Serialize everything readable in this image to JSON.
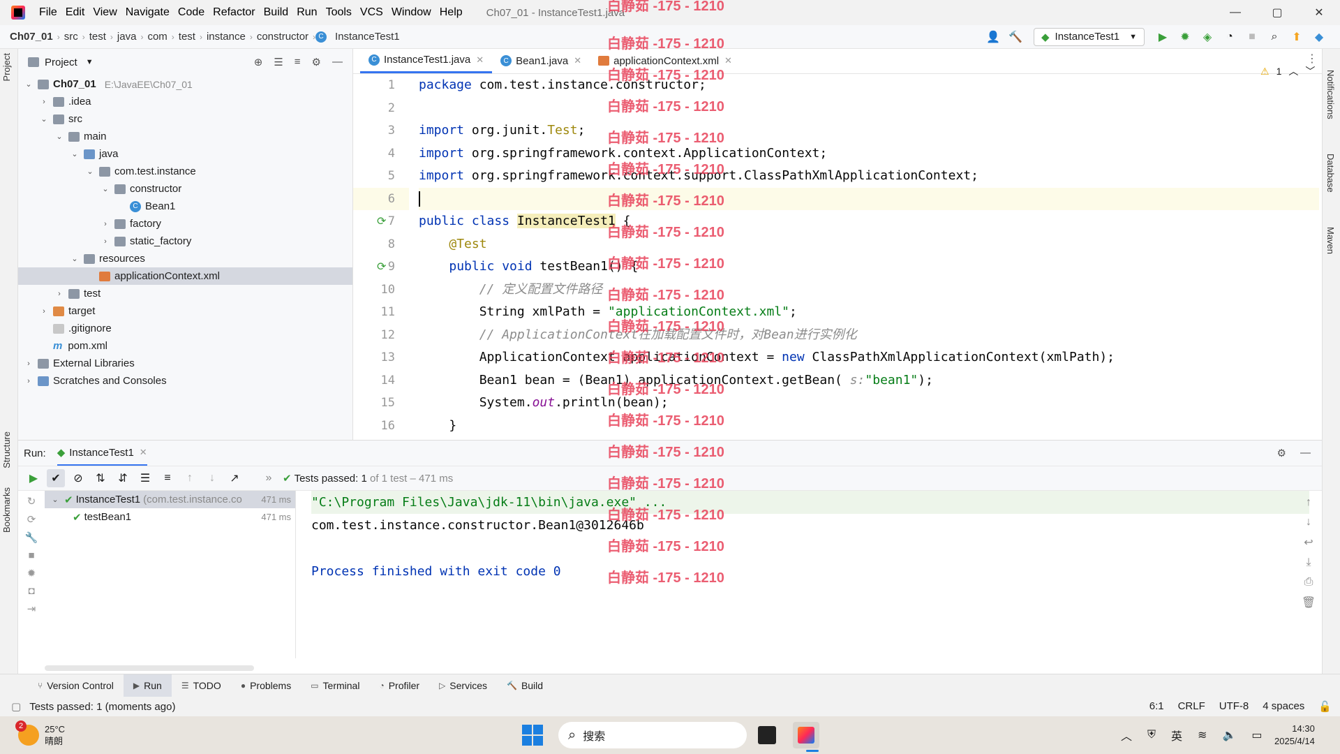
{
  "window": {
    "title": "Ch07_01 - InstanceTest1.java",
    "minimize_icon": "—",
    "maximize_icon": "▢",
    "close_icon": "✕"
  },
  "menu": [
    "File",
    "Edit",
    "View",
    "Navigate",
    "Code",
    "Refactor",
    "Build",
    "Run",
    "Tools",
    "VCS",
    "Window",
    "Help"
  ],
  "breadcrumb": [
    "Ch07_01",
    "src",
    "test",
    "java",
    "com",
    "test",
    "instance",
    "constructor",
    "InstanceTest1"
  ],
  "toolbar": {
    "run_config": "InstanceTest1"
  },
  "project": {
    "header": "Project",
    "tree": [
      {
        "label": "Ch07_01",
        "extra": "E:\\JavaEE\\Ch07_01",
        "depth": 0,
        "open": true,
        "icon": "module-folder",
        "bold": true
      },
      {
        "label": ".idea",
        "depth": 1,
        "open": false,
        "icon": "folder"
      },
      {
        "label": "src",
        "depth": 1,
        "open": true,
        "icon": "folder"
      },
      {
        "label": "main",
        "depth": 2,
        "open": true,
        "icon": "folder"
      },
      {
        "label": "java",
        "depth": 3,
        "open": true,
        "icon": "source-folder"
      },
      {
        "label": "com.test.instance",
        "depth": 4,
        "open": true,
        "icon": "package"
      },
      {
        "label": "constructor",
        "depth": 5,
        "open": true,
        "icon": "package"
      },
      {
        "label": "Bean1",
        "depth": 6,
        "icon": "class"
      },
      {
        "label": "factory",
        "depth": 5,
        "open": false,
        "icon": "package"
      },
      {
        "label": "static_factory",
        "depth": 5,
        "open": false,
        "icon": "package"
      },
      {
        "label": "resources",
        "depth": 3,
        "open": true,
        "icon": "resources-folder"
      },
      {
        "label": "applicationContext.xml",
        "depth": 4,
        "icon": "xml",
        "selected": true
      },
      {
        "label": "test",
        "depth": 2,
        "open": false,
        "icon": "folder"
      },
      {
        "label": "target",
        "depth": 1,
        "open": false,
        "icon": "excluded-folder"
      },
      {
        "label": ".gitignore",
        "depth": 1,
        "icon": "file"
      },
      {
        "label": "pom.xml",
        "depth": 1,
        "icon": "maven"
      },
      {
        "label": "External Libraries",
        "depth": 0,
        "open": false,
        "icon": "libraries"
      },
      {
        "label": "Scratches and Consoles",
        "depth": 0,
        "open": false,
        "icon": "scratches"
      }
    ]
  },
  "tabs": [
    {
      "label": "InstanceTest1.java",
      "active": true
    },
    {
      "label": "Bean1.java",
      "active": false
    },
    {
      "label": "applicationContext.xml",
      "active": false
    }
  ],
  "editor": {
    "warning_count": "1",
    "line_numbers": [
      "1",
      "2",
      "3",
      "4",
      "5",
      "6",
      "7",
      "8",
      "9",
      "10",
      "11",
      "12",
      "13",
      "14",
      "15",
      "16"
    ],
    "lines": [
      [
        [
          "kw",
          "package"
        ],
        [
          "",
          "com.test.instance.constructor;"
        ]
      ],
      [],
      [
        [
          "kw",
          "import"
        ],
        [
          "",
          "org.junit."
        ],
        [
          "ann",
          "Test"
        ],
        [
          "",
          ";"
        ]
      ],
      [
        [
          "kw",
          "import"
        ],
        [
          "",
          "org.springframework.context.ApplicationContext;"
        ]
      ],
      [
        [
          "kw",
          "import"
        ],
        [
          "",
          "org.springframework.context.support.ClassPathXmlApplicationContext;"
        ]
      ],
      [],
      [
        [
          "kw",
          "public class"
        ],
        [
          "",
          ""
        ],
        [
          "cls",
          "InstanceTest1"
        ],
        [
          "",
          " {"
        ]
      ],
      [
        [
          "",
          "    "
        ],
        [
          "ann",
          "@Test"
        ]
      ],
      [
        [
          "",
          "    "
        ],
        [
          "kw",
          "public void"
        ],
        [
          "",
          " testBean1() {"
        ]
      ],
      [
        [
          "",
          "        "
        ],
        [
          "cmt",
          "// 定义配置文件路径"
        ]
      ],
      [
        [
          "",
          "        String xmlPath = "
        ],
        [
          "str",
          "\"applicationContext.xml\""
        ],
        [
          "",
          ";"
        ]
      ],
      [
        [
          "",
          "        "
        ],
        [
          "cmt",
          "// ApplicationContext在加载配置文件时，对Bean进行实例化"
        ]
      ],
      [
        [
          "",
          "        ApplicationContext applicationContext = "
        ],
        [
          "kw",
          "new"
        ],
        [
          "",
          " ClassPathXmlApplicationContext(xmlPath);"
        ]
      ],
      [
        [
          "",
          "        Bean1 bean = (Bean1) applicationContext.getBean( "
        ],
        [
          "cmt",
          "s:"
        ],
        [
          " ",
          ""
        ],
        [
          "str",
          "\"bean1\""
        ],
        [
          "",
          ");"
        ]
      ],
      [
        [
          "",
          "        System."
        ],
        [
          "ital",
          "out"
        ],
        [
          "",
          ".println(bean);"
        ]
      ],
      [
        [
          "",
          "    }"
        ]
      ]
    ]
  },
  "run": {
    "label": "Run:",
    "tab": "InstanceTest1",
    "status_prefix": "Tests passed:",
    "status_count": "1",
    "status_suffix": "of 1 test – 471 ms",
    "tests": [
      {
        "name": "InstanceTest1",
        "detail": "(com.test.instance.co",
        "time": "471 ms"
      },
      {
        "name": "testBean1",
        "detail": "",
        "time": "471 ms"
      }
    ],
    "console": [
      {
        "text": "\"C:\\Program Files\\Java\\jdk-11\\bin\\java.exe\" ...",
        "color": "#067d17"
      },
      {
        "text": "com.test.instance.constructor.Bean1@3012646b",
        "color": "#080808"
      },
      {
        "text": "",
        "color": "#080808"
      },
      {
        "text": "Process finished with exit code 0",
        "color": "#0033b3"
      }
    ]
  },
  "bottom_tabs": [
    "Version Control",
    "Run",
    "TODO",
    "Problems",
    "Terminal",
    "Profiler",
    "Services",
    "Build"
  ],
  "status": {
    "message": "Tests passed: 1 (moments ago)",
    "position": "6:1",
    "line_sep": "CRLF",
    "encoding": "UTF-8",
    "indent": "4 spaces"
  },
  "side_labels": {
    "project": "Project",
    "structure": "Structure",
    "bookmarks": "Bookmarks",
    "notifications": "Notifications",
    "database": "Database",
    "maven": "Maven"
  },
  "taskbar": {
    "weather_badge": "2",
    "temp": "25°C",
    "weather": "晴朗",
    "search": "搜索",
    "ime": "英",
    "time": "14:30",
    "date": "2025/4/14"
  },
  "watermark": "白静茹 -175 - 1210"
}
